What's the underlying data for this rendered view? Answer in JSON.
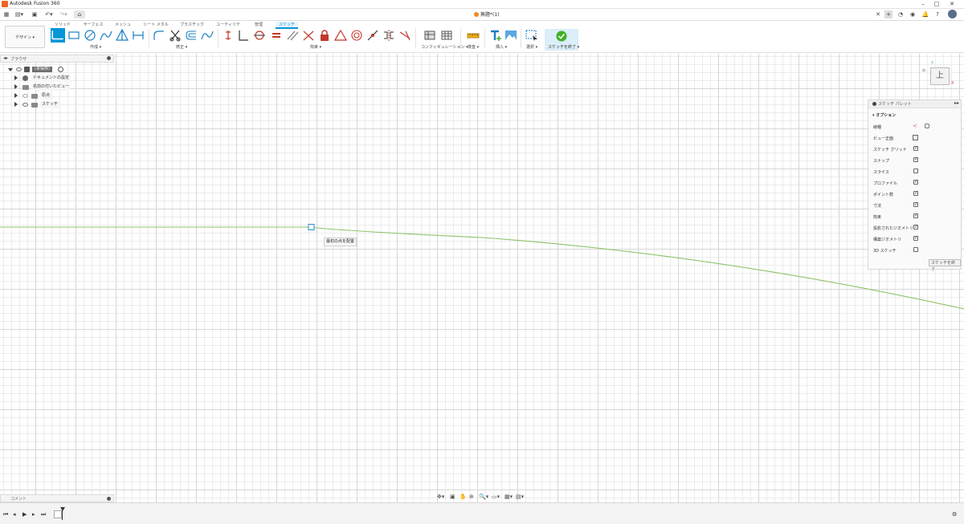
{
  "app": {
    "title": "Autodesk Fusion 360",
    "document_tab": "無題*(1)"
  },
  "ribbon_tabs": [
    {
      "label": "ソリッド"
    },
    {
      "label": "サーフェス"
    },
    {
      "label": "メッシュ"
    },
    {
      "label": "シート メタル"
    },
    {
      "label": "プラスチック"
    },
    {
      "label": "ユーティリティ"
    },
    {
      "label": "管理"
    },
    {
      "label": "スケッチ",
      "active": true
    }
  ],
  "toolbar": {
    "workspace_label": "デザイン ▾",
    "groups": {
      "create": "作成 ▾",
      "modify": "修正 ▾",
      "constraints": "拘束 ▾",
      "configure": "コンフィギュレーション ▾",
      "inspect": "検査 ▾",
      "insert": "挿入 ▾",
      "select": "選択 ▾",
      "finish": "スケッチを終了 ▾"
    }
  },
  "browser": {
    "header": "ブラウザ",
    "root": "(未保存)",
    "items": [
      {
        "label": "ドキュメントの設定"
      },
      {
        "label": "名前の付いたビュー"
      },
      {
        "label": "原点"
      },
      {
        "label": "スケッチ"
      }
    ]
  },
  "canvas": {
    "tooltip": "最初の点を配置"
  },
  "viewcube": {
    "face": "上",
    "axis_x": "X",
    "axis_y": "Y"
  },
  "sketch_palette": {
    "header": "スケッチ パレット",
    "section": "オプション",
    "rows": [
      {
        "label": "線種"
      },
      {
        "label": "ビュー正面"
      },
      {
        "label": "スケッチ グリッド",
        "checked": true
      },
      {
        "label": "スナップ",
        "checked": true
      },
      {
        "label": "スライス",
        "checked": false
      },
      {
        "label": "プロファイル",
        "checked": true
      },
      {
        "label": "ポイント数",
        "checked": true
      },
      {
        "label": "寸法",
        "checked": true
      },
      {
        "label": "拘束",
        "checked": true
      },
      {
        "label": "投影されたジオメトリ",
        "checked": true
      },
      {
        "label": "構築ジオメトリ",
        "checked": true
      },
      {
        "label": "3D スケッチ",
        "checked": false
      }
    ],
    "finish_button": "スケッチを終了"
  },
  "comments": {
    "label": "コメント"
  },
  "colors": {
    "accent": "#0696d7",
    "sketch_line": "#8dc26a",
    "finish_green": "#43b02a"
  }
}
